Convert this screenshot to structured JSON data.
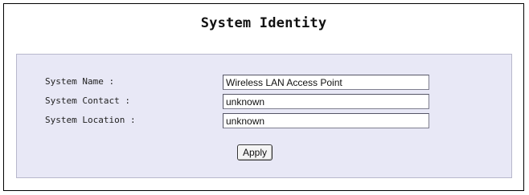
{
  "page": {
    "title": "System Identity"
  },
  "form": {
    "system_name": {
      "label": "System Name :",
      "value": "Wireless LAN Access Point"
    },
    "system_contact": {
      "label": "System Contact :",
      "value": "unknown"
    },
    "system_location": {
      "label": "System Location :",
      "value": "unknown"
    },
    "apply_label": "Apply"
  },
  "colors": {
    "panel_background": "#e8e8f6",
    "frame_border": "#000000"
  }
}
